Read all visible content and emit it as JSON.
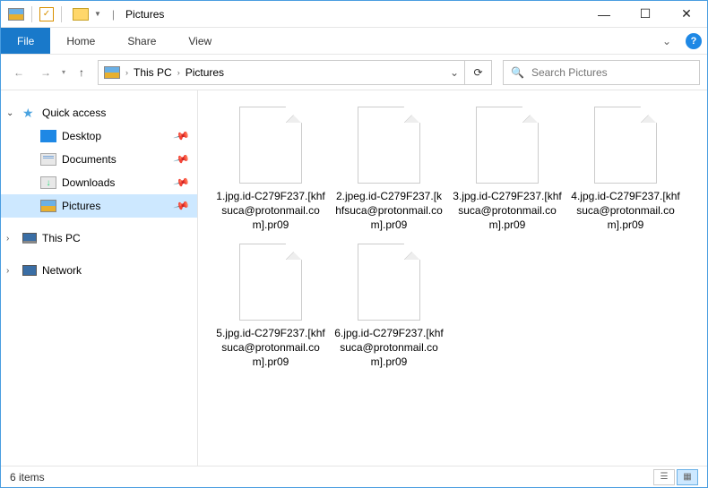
{
  "title": "Pictures",
  "ribbon": {
    "file": "File",
    "tabs": [
      "Home",
      "Share",
      "View"
    ]
  },
  "breadcrumbs": [
    "This PC",
    "Pictures"
  ],
  "search": {
    "placeholder": "Search Pictures"
  },
  "sidebar": {
    "quick_access": "Quick access",
    "items": [
      {
        "label": "Desktop"
      },
      {
        "label": "Documents"
      },
      {
        "label": "Downloads"
      },
      {
        "label": "Pictures"
      }
    ],
    "this_pc": "This PC",
    "network": "Network"
  },
  "files": [
    {
      "name": "1.jpg.id-C279F237.[khfsuca@protonmail.com].pr09"
    },
    {
      "name": "2.jpeg.id-C279F237.[khfsuca@protonmail.com].pr09"
    },
    {
      "name": "3.jpg.id-C279F237.[khfsuca@protonmail.com].pr09"
    },
    {
      "name": "4.jpg.id-C279F237.[khfsuca@protonmail.com].pr09"
    },
    {
      "name": "5.jpg.id-C279F237.[khfsuca@protonmail.com].pr09"
    },
    {
      "name": "6.jpg.id-C279F237.[khfsuca@protonmail.com].pr09"
    }
  ],
  "status": {
    "count": "6 items"
  }
}
